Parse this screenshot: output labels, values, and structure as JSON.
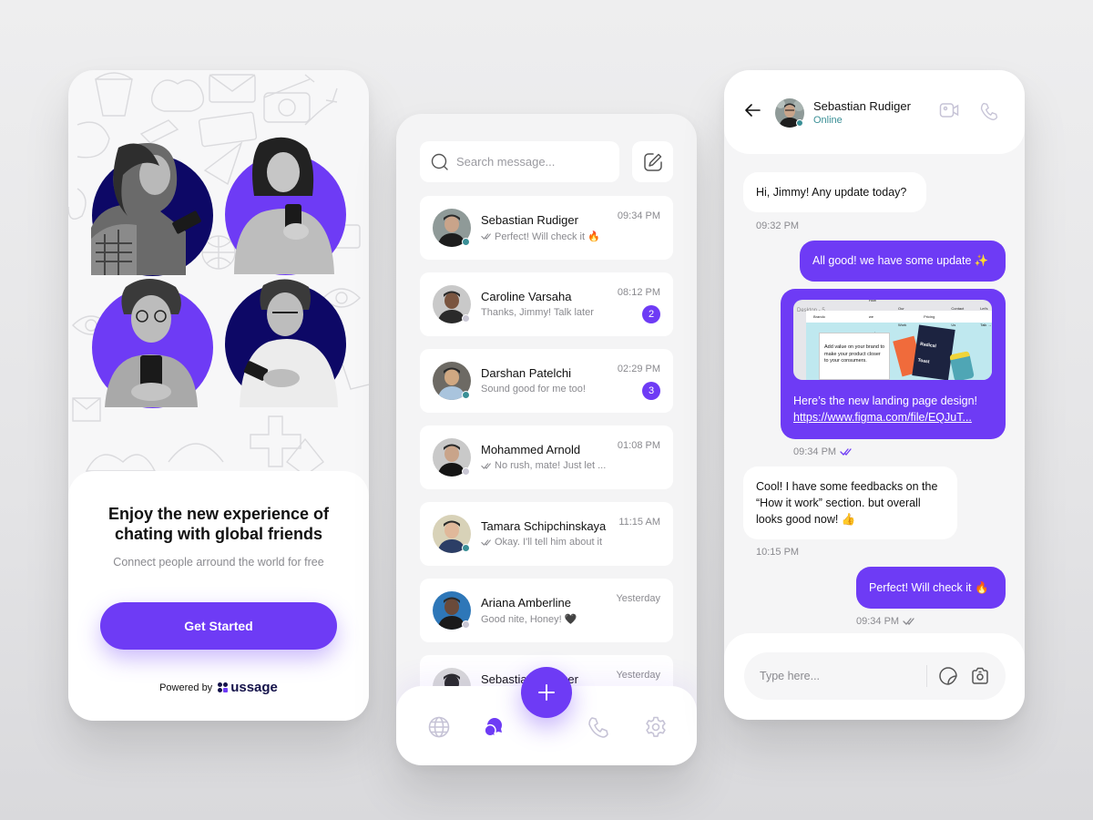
{
  "colors": {
    "accent": "#6e3bf5",
    "navy": "#0d0866",
    "online": "#3a8f96",
    "offline": "#c9c7d4",
    "muted_text": "#8a8a8f"
  },
  "onboarding": {
    "title": "Enjoy the new experience of chating with global friends",
    "subtitle": "Connect people arround the world for free",
    "cta_label": "Get Started",
    "powered_by": "Powered by",
    "brand_name": "ussage",
    "photos": [
      {
        "desc": "woman-with-phone",
        "disc_color": "navy"
      },
      {
        "desc": "woman-smiling-phone",
        "disc_color": "accent"
      },
      {
        "desc": "man-glasses-phone",
        "disc_color": "accent"
      },
      {
        "desc": "man-white-shirt-phone",
        "disc_color": "navy"
      }
    ]
  },
  "chat_list": {
    "search_placeholder": "Search message...",
    "compose_icon": "edit-icon",
    "items": [
      {
        "name": "Sebastian Rudiger",
        "preview": "Perfect! Will check it 🔥",
        "time": "09:34 PM",
        "read_ticks": true,
        "unread": "",
        "online": true
      },
      {
        "name": "Caroline Varsaha",
        "preview": "Thanks, Jimmy! Talk later",
        "time": "08:12 PM",
        "read_ticks": false,
        "unread": "2",
        "online": false
      },
      {
        "name": "Darshan Patelchi",
        "preview": "Sound good for me too!",
        "time": "02:29 PM",
        "read_ticks": false,
        "unread": "3",
        "online": true
      },
      {
        "name": "Mohammed Arnold",
        "preview": "No rush, mate! Just let ...",
        "time": "01:08 PM",
        "read_ticks": true,
        "unread": "",
        "online": false
      },
      {
        "name": "Tamara Schipchinskaya",
        "preview": "Okay. I'll tell him about it",
        "time": "11:15 AM",
        "read_ticks": true,
        "unread": "",
        "online": true
      },
      {
        "name": "Ariana Amberline",
        "preview": "Good nite, Honey! 🖤",
        "time": "Yesterday",
        "read_ticks": false,
        "unread": "",
        "online": false
      },
      {
        "name": "Sebastian Rudiger",
        "preview": "",
        "time": "Yesterday",
        "read_ticks": false,
        "unread": "",
        "online": false
      }
    ],
    "nav": [
      {
        "icon": "globe-icon",
        "label": "Explore",
        "active": false
      },
      {
        "icon": "chat-bubbles-icon",
        "label": "Chats",
        "active": true
      },
      {
        "icon": "phone-icon",
        "label": "Calls",
        "active": false
      },
      {
        "icon": "gear-icon",
        "label": "Settings",
        "active": false
      }
    ],
    "fab_icon": "plus-icon"
  },
  "conversation": {
    "contact_name": "Sebastian Rudiger",
    "contact_status": "Online",
    "messages": [
      {
        "dir": "in",
        "text": "Hi, Jimmy! Any update today?",
        "time": "09:32 PM"
      },
      {
        "dir": "out",
        "text": "All good! we have some update ✨",
        "time": ""
      },
      {
        "dir": "out",
        "preview_label": "Desktop - 5",
        "preview_brand": "Brando",
        "preview_nav": [
          "How we work",
          "Our Work",
          "Pricing",
          "Contact Us"
        ],
        "preview_cta": "Let's Talk →",
        "preview_headline": "Add value on your brand to make your product closer to your consumers.",
        "preview_product": "Radical Toast",
        "text": "Here’s the new landing page design!",
        "link": "https://www.figma.com/file/EQJuT...",
        "time": "09:34 PM",
        "read": true
      },
      {
        "dir": "in",
        "text": "Cool! I have some feedbacks on the “How it work” section. but overall looks good now! 👍",
        "time": "10:15 PM"
      },
      {
        "dir": "out",
        "text": "Perfect! Will check it 🔥",
        "time": "09:34 PM",
        "read": false
      }
    ],
    "input_placeholder": "Type here..."
  }
}
